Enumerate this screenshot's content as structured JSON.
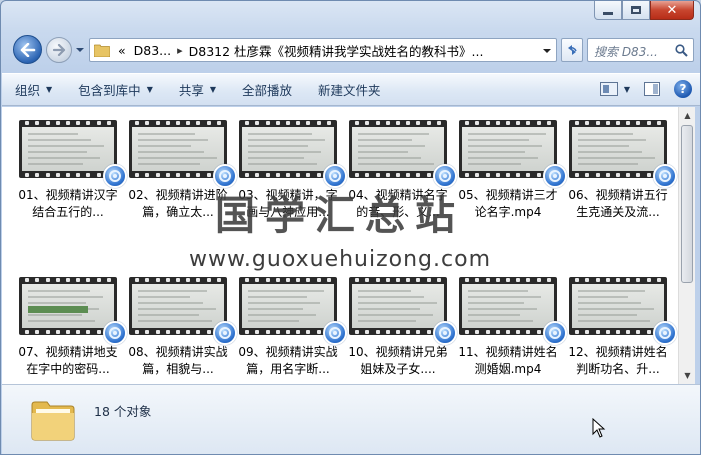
{
  "window": {
    "minimize_icon": "minimize-icon",
    "maximize_icon": "maximize-icon",
    "close_icon": "close-icon"
  },
  "address": {
    "overflow_marker": "«",
    "crumbs": [
      "D83...",
      "D8312 杜彦霖《视频精讲我学实战姓名的教科书》..."
    ],
    "search_placeholder": "搜索 D83..."
  },
  "toolbar": {
    "organize": "组织",
    "include_in_library": "包含到库中",
    "share": "共享",
    "play_all": "全部播放",
    "new_folder": "新建文件夹"
  },
  "files": [
    {
      "name": "01、视频精讲汉字结合五行的..."
    },
    {
      "name": "02、视频精讲进阶篇，确立太..."
    },
    {
      "name": "03、视频精讲，字画与八神应用..."
    },
    {
      "name": "04、视频精讲名字的音、形、义..."
    },
    {
      "name": "05、视频精讲三才论名字.mp4"
    },
    {
      "name": "06、视频精讲五行生克通关及流..."
    },
    {
      "name": "07、视频精讲地支在字中的密码..."
    },
    {
      "name": "08、视频精讲实战篇，相貌与..."
    },
    {
      "name": "09、视频精讲实战篇，用名字断..."
    },
    {
      "name": "10、视频精讲兄弟姐妹及子女...."
    },
    {
      "name": "11、视频精讲姓名测婚姻.mp4"
    },
    {
      "name": "12、视频精讲姓名判断功名、升..."
    }
  ],
  "watermark": {
    "title": "国学汇总站",
    "url": "www.guoxuehuizong.com"
  },
  "details": {
    "count_text": "18 个对象"
  }
}
